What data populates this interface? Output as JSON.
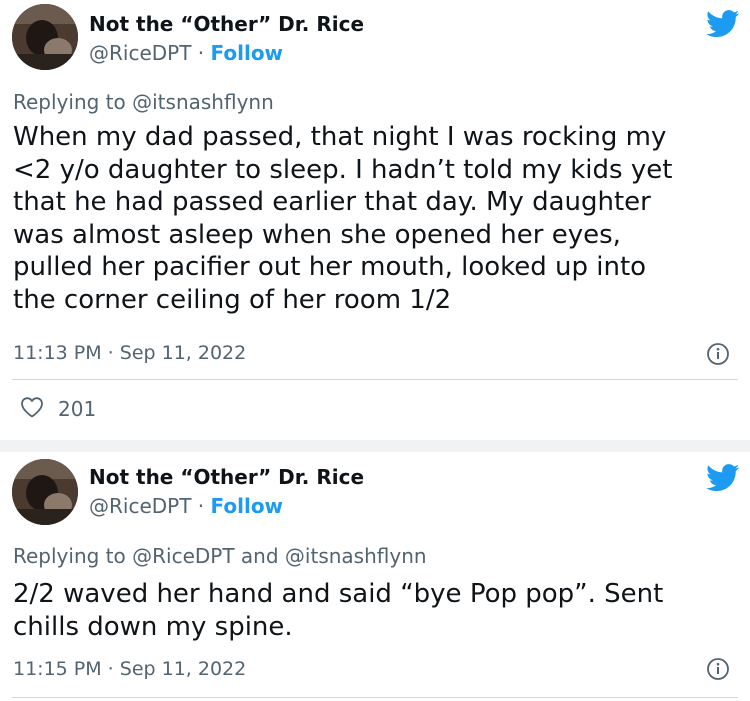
{
  "tweets": [
    {
      "author_name": "Not the “Other” Dr. Rice",
      "handle": "@RiceDPT",
      "separator": "·",
      "follow_label": "Follow",
      "replying_prefix": "Replying to",
      "replying_to": "@itsnashflynn",
      "text_lines": [
        "When my dad passed, that night I was rocking my",
        "<2 y/o daughter to sleep. I hadn’t told my kids yet",
        "that he had passed earlier that day. My daughter",
        "was almost asleep when she opened her eyes,",
        "pulled her pacifier out her mouth, looked up into",
        "the corner ceiling of her room 1/2"
      ],
      "timestamp": "11:13 PM · Sep 11, 2022",
      "like_count": "201"
    },
    {
      "author_name": "Not the “Other” Dr. Rice",
      "handle": "@RiceDPT",
      "separator": "·",
      "follow_label": "Follow",
      "replying_prefix": "Replying to",
      "replying_to": "@RiceDPT",
      "replying_joiner": "and",
      "replying_to_2": "@itsnashflynn",
      "text_lines": [
        "2/2 waved her hand and said “bye Pop pop”. Sent",
        "chills down my spine."
      ],
      "timestamp": "11:15 PM · Sep 11, 2022"
    }
  ],
  "icons": {
    "brand": "twitter-bird-icon",
    "info": "info-icon",
    "like": "heart-icon"
  },
  "colors": {
    "brand_blue": "#1d9bf0",
    "secondary_text": "#536471",
    "primary_text": "#0f1419",
    "divider": "#cfd9de"
  }
}
